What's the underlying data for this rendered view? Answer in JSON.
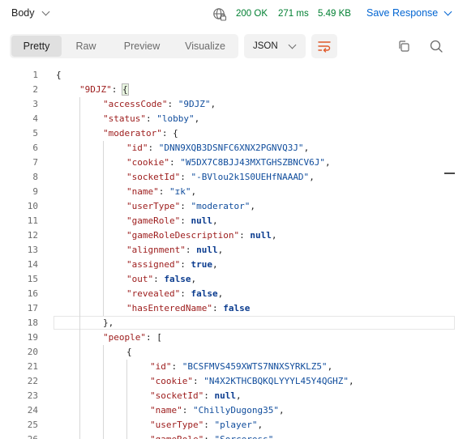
{
  "response_header": {
    "body_label": "Body",
    "status": "200 OK",
    "time": "271 ms",
    "size": "5.49 KB",
    "save_label": "Save Response",
    "icons": {
      "dropdown": "chevron-down-icon",
      "network": "globe-lock-icon"
    }
  },
  "view_tabs": [
    {
      "label": "Pretty",
      "active": true
    },
    {
      "label": "Raw",
      "active": false
    },
    {
      "label": "Preview",
      "active": false
    },
    {
      "label": "Visualize",
      "active": false
    }
  ],
  "format_select": {
    "value": "JSON"
  },
  "toolbar_icons": [
    "wrap-lines-icon",
    "copy-icon",
    "search-icon"
  ],
  "colors": {
    "key": "#9c1b1b",
    "string": "#0f4c9c",
    "keyword": "#0b3c8f",
    "status_ok": "#007f31",
    "link": "#0265d2"
  },
  "code_lines": [
    {
      "n": "1",
      "t": [
        [
          "p",
          "{"
        ]
      ]
    },
    {
      "n": "2",
      "t": [
        [
          "k",
          "\"9DJZ\""
        ],
        [
          "p",
          ": "
        ],
        [
          "m",
          "{"
        ]
      ]
    },
    {
      "n": "3",
      "t": [
        [
          "k",
          "\"accessCode\""
        ],
        [
          "p",
          ": "
        ],
        [
          "s",
          "\"9DJZ\""
        ],
        [
          "p",
          ","
        ]
      ]
    },
    {
      "n": "4",
      "t": [
        [
          "k",
          "\"status\""
        ],
        [
          "p",
          ": "
        ],
        [
          "s",
          "\"lobby\""
        ],
        [
          "p",
          ","
        ]
      ]
    },
    {
      "n": "5",
      "t": [
        [
          "k",
          "\"moderator\""
        ],
        [
          "p",
          ": {"
        ]
      ]
    },
    {
      "n": "6",
      "t": [
        [
          "k",
          "\"id\""
        ],
        [
          "p",
          ": "
        ],
        [
          "s",
          "\"DNN9XQB3DSNFC6XNX2PGNVQ3J\""
        ],
        [
          "p",
          ","
        ]
      ]
    },
    {
      "n": "7",
      "t": [
        [
          "k",
          "\"cookie\""
        ],
        [
          "p",
          ": "
        ],
        [
          "s",
          "\"W5DX7C8BJJ43MXTGHSZBNCV6J\""
        ],
        [
          "p",
          ","
        ]
      ]
    },
    {
      "n": "8",
      "t": [
        [
          "k",
          "\"socketId\""
        ],
        [
          "p",
          ": "
        ],
        [
          "s",
          "\"-BVlou2k1S0UEHfNAAAD\""
        ],
        [
          "p",
          ","
        ]
      ]
    },
    {
      "n": "9",
      "t": [
        [
          "k",
          "\"name\""
        ],
        [
          "p",
          ": "
        ],
        [
          "s",
          "\"ɪk\""
        ],
        [
          "p",
          ","
        ]
      ]
    },
    {
      "n": "10",
      "t": [
        [
          "k",
          "\"userType\""
        ],
        [
          "p",
          ": "
        ],
        [
          "s",
          "\"moderator\""
        ],
        [
          "p",
          ","
        ]
      ]
    },
    {
      "n": "11",
      "t": [
        [
          "k",
          "\"gameRole\""
        ],
        [
          "p",
          ": "
        ],
        [
          "w",
          "null"
        ],
        [
          "p",
          ","
        ]
      ]
    },
    {
      "n": "12",
      "t": [
        [
          "k",
          "\"gameRoleDescription\""
        ],
        [
          "p",
          ": "
        ],
        [
          "w",
          "null"
        ],
        [
          "p",
          ","
        ]
      ]
    },
    {
      "n": "13",
      "t": [
        [
          "k",
          "\"alignment\""
        ],
        [
          "p",
          ": "
        ],
        [
          "w",
          "null"
        ],
        [
          "p",
          ","
        ]
      ]
    },
    {
      "n": "14",
      "t": [
        [
          "k",
          "\"assigned\""
        ],
        [
          "p",
          ": "
        ],
        [
          "w",
          "true"
        ],
        [
          "p",
          ","
        ]
      ]
    },
    {
      "n": "15",
      "t": [
        [
          "k",
          "\"out\""
        ],
        [
          "p",
          ": "
        ],
        [
          "w",
          "false"
        ],
        [
          "p",
          ","
        ]
      ]
    },
    {
      "n": "16",
      "t": [
        [
          "k",
          "\"revealed\""
        ],
        [
          "p",
          ": "
        ],
        [
          "w",
          "false"
        ],
        [
          "p",
          ","
        ]
      ]
    },
    {
      "n": "17",
      "t": [
        [
          "k",
          "\"hasEnteredName\""
        ],
        [
          "p",
          ": "
        ],
        [
          "w",
          "false"
        ]
      ]
    },
    {
      "n": "18",
      "t": [
        [
          "p",
          "},"
        ]
      ]
    },
    {
      "n": "19",
      "t": [
        [
          "k",
          "\"people\""
        ],
        [
          "p",
          ": ["
        ]
      ]
    },
    {
      "n": "20",
      "t": [
        [
          "p",
          "{"
        ]
      ]
    },
    {
      "n": "21",
      "t": [
        [
          "k",
          "\"id\""
        ],
        [
          "p",
          ": "
        ],
        [
          "s",
          "\"BCSFMVS459XWTS7NNXSYRKLZ5\""
        ],
        [
          "p",
          ","
        ]
      ]
    },
    {
      "n": "22",
      "t": [
        [
          "k",
          "\"cookie\""
        ],
        [
          "p",
          ": "
        ],
        [
          "s",
          "\"N4X2KTHCBQKQLYYYL45Y4QGHZ\""
        ],
        [
          "p",
          ","
        ]
      ]
    },
    {
      "n": "23",
      "t": [
        [
          "k",
          "\"socketId\""
        ],
        [
          "p",
          ": "
        ],
        [
          "w",
          "null"
        ],
        [
          "p",
          ","
        ]
      ]
    },
    {
      "n": "24",
      "t": [
        [
          "k",
          "\"name\""
        ],
        [
          "p",
          ": "
        ],
        [
          "s",
          "\"ChillyDugong35\""
        ],
        [
          "p",
          ","
        ]
      ]
    },
    {
      "n": "25",
      "t": [
        [
          "k",
          "\"userType\""
        ],
        [
          "p",
          ": "
        ],
        [
          "s",
          "\"player\""
        ],
        [
          "p",
          ","
        ]
      ]
    },
    {
      "n": "26",
      "t": [
        [
          "k",
          "\"gameRole\""
        ],
        [
          "p",
          ": "
        ],
        [
          "s",
          "\"Sorceress\""
        ]
      ]
    }
  ]
}
